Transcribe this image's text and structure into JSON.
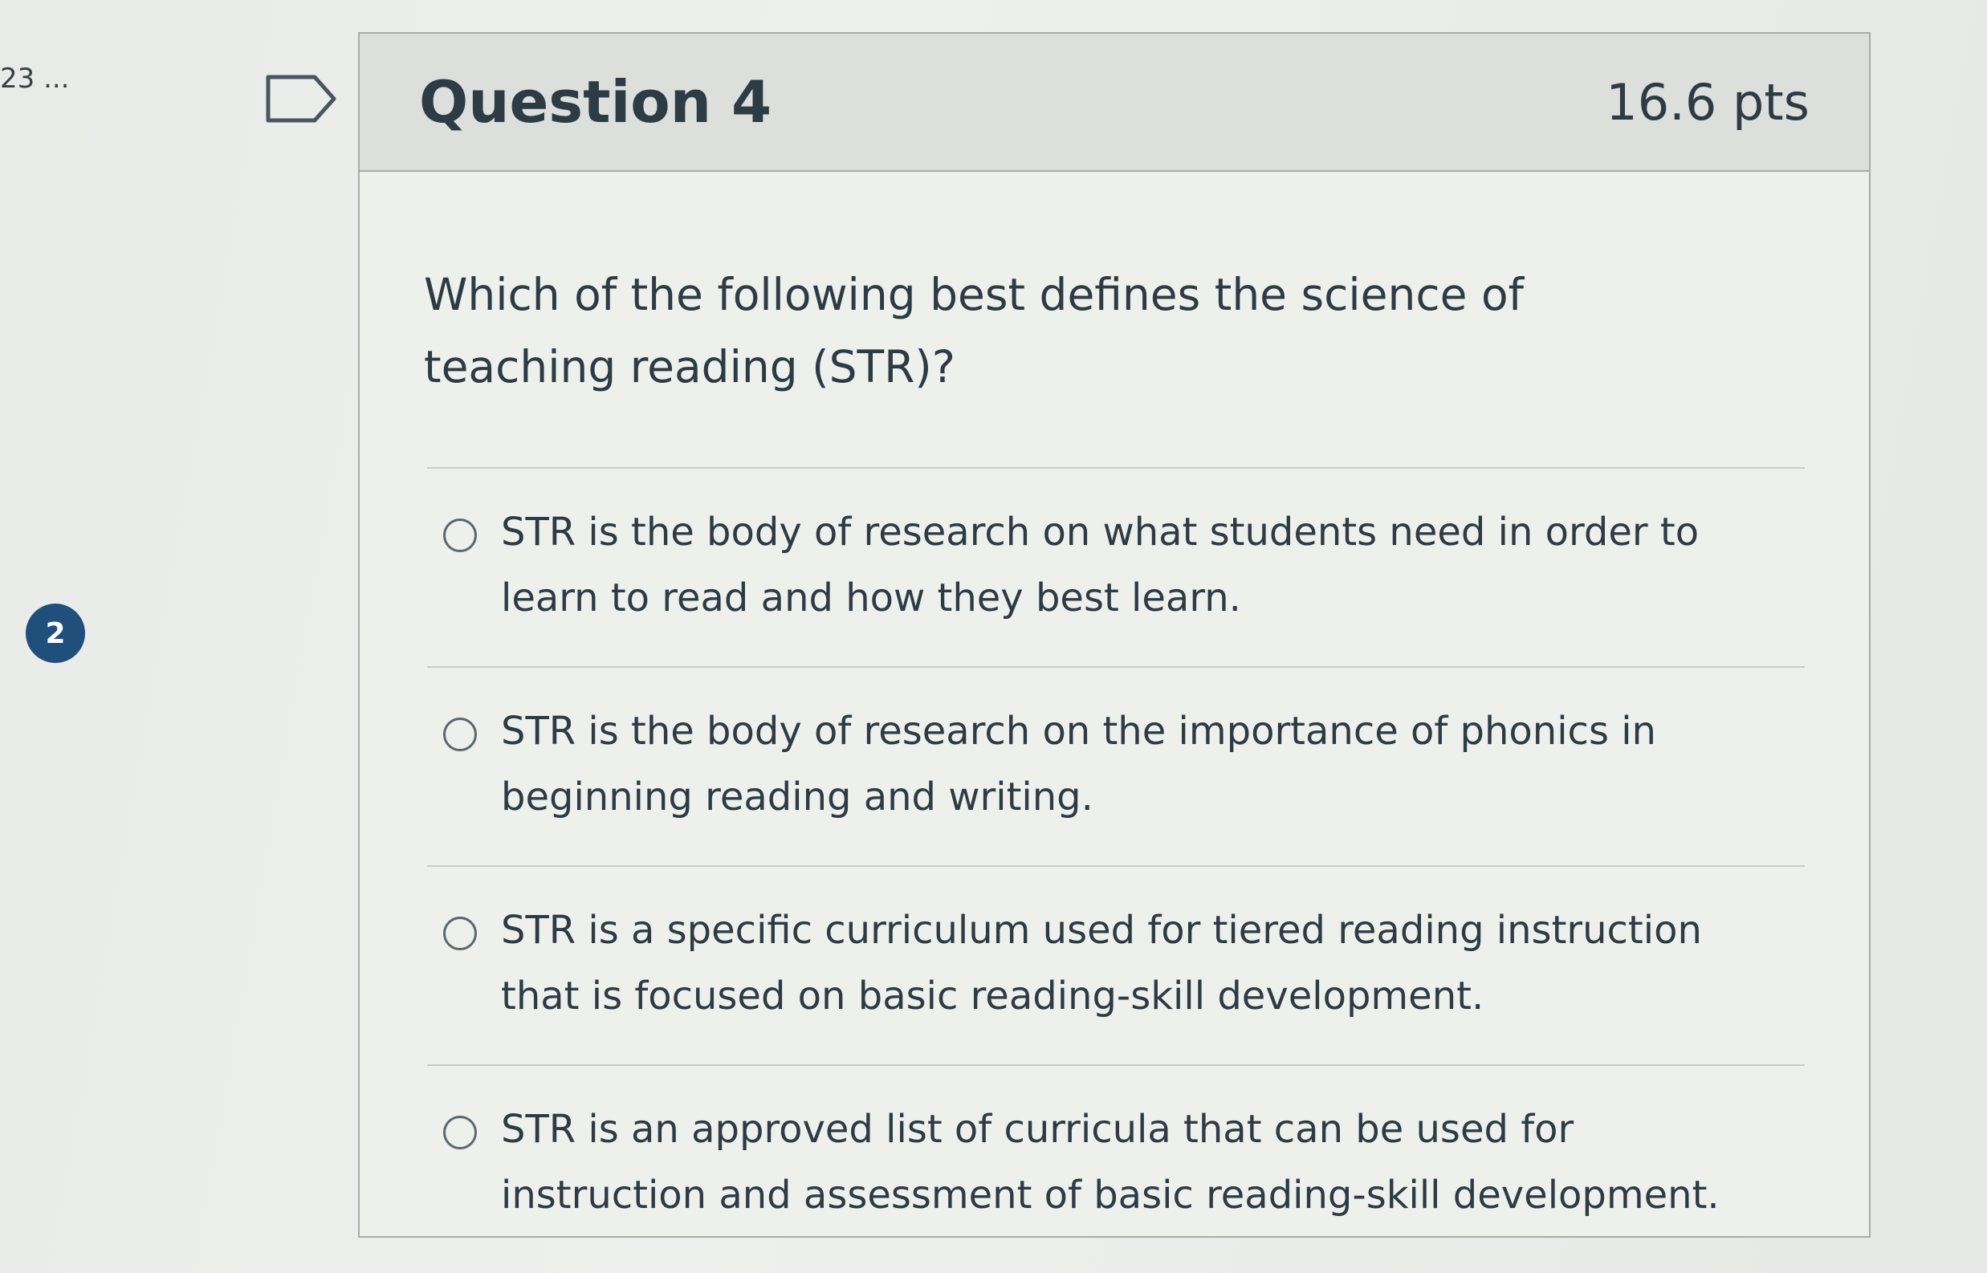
{
  "side_label": "23 ...",
  "badge_number": "2",
  "question": {
    "title": "Question 4",
    "points": "16.6 pts",
    "text": "Which of the following best defines the science of teaching reading (STR)?",
    "answers": [
      {
        "label": "STR is the body of research on what students need in order to learn to read and how they best learn."
      },
      {
        "label": "STR is the body of research on the importance of phonics in beginning reading and writing."
      },
      {
        "label": "STR is a specific curriculum used for tiered reading instruction that is focused on basic reading-skill development."
      },
      {
        "label": "STR is an approved list of curricula that can be used for instruction and assessment of basic reading-skill development."
      }
    ]
  },
  "icons": {
    "flag": "flag-outline-icon",
    "radio": "radio-unselected-icon"
  },
  "colors": {
    "badge": "#1f4f7a",
    "header_bg": "#dcdfdb",
    "text": "#2d3b45"
  }
}
